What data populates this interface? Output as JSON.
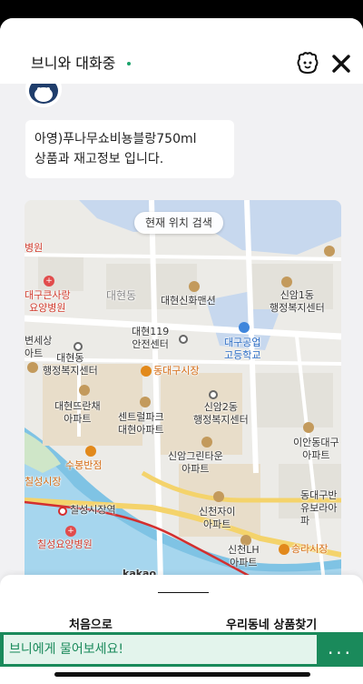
{
  "header": {
    "title": "브니와 대화중",
    "mascot_icon": "mascot-face-icon",
    "close_icon": "close-icon",
    "status_color": "#1aa36b"
  },
  "chat": {
    "bubble_lines": [
      "아영)푸나무쇼비뇽블랑750ml",
      "상품과 재고정보 입니다."
    ]
  },
  "map": {
    "search_here": "현재 위치 검색",
    "provider": "kakao",
    "labels": {
      "hospital_top": "병원",
      "hospital_daegu": "대구큰사랑\n요양병원",
      "daehyeon_dong": "대현동",
      "daehyeon_shinhwa": "대현신화맨션",
      "sinam1": "신암1동\n행정복지센터",
      "welfare": "변세상\n아트",
      "daehyeon_center": "대현동\n행정복지센터",
      "daehyeon119": "대현119\n안전센터",
      "daegu_tech": "대구공업\n고등학교",
      "dongdaegu_market": "동대구시장",
      "daehyeon_apt": "대현뜨란채\n아파트",
      "central_park": "센트럴파크\n대현아파트",
      "sinam2": "신암2동\n행정복지센터",
      "ian_apt": "이안동대구\n아파트",
      "subong": "수봉반점",
      "sinam_green": "신암그린타운\n아파트",
      "chilseong_market": "칠성시장",
      "dongdaegu_river": "동대구반\n유보라아파",
      "chilseong_station": "칠성시장역",
      "sincheon_xi": "신천자이\n아파트",
      "chilseong_hospital": "칠성요양병원",
      "sincheon_lh": "신천LH\n아파트",
      "songra_market": "송라시장"
    }
  },
  "bottom": {
    "nav_left": "처음으로",
    "nav_right": "우리동네 상품찾기",
    "input_placeholder": "브니에게 물어보세요!",
    "more_label": "...",
    "accent_color": "#1a8a5b"
  }
}
